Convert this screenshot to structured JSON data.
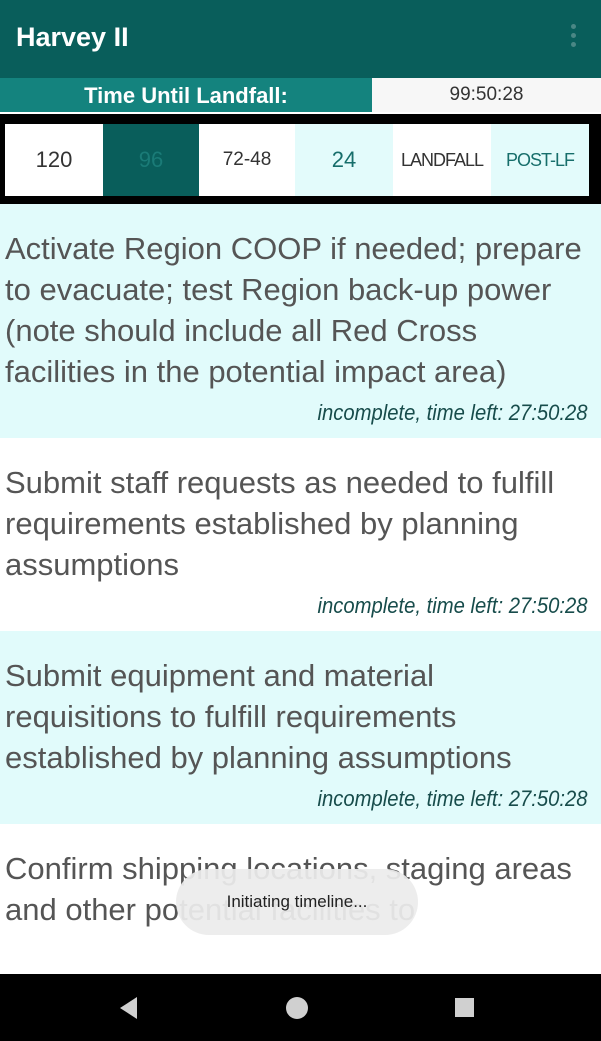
{
  "appbar": {
    "title": "Harvey II",
    "menu_icon": "more-vert-icon"
  },
  "countdown": {
    "label": "Time Until Landfall:",
    "value": "99:50:28"
  },
  "phases": [
    {
      "label": "120",
      "state": "default"
    },
    {
      "label": "96",
      "state": "selected"
    },
    {
      "label": "72-48",
      "state": "default"
    },
    {
      "label": "24",
      "state": "default"
    },
    {
      "label": "LANDFALL",
      "state": "default"
    },
    {
      "label": "POST-LF",
      "state": "default"
    }
  ],
  "tasks": [
    {
      "text": "Activate Region COOP if needed; prepare to evacuate; test Region back-up power (note should include all Red Cross facilities in the potential impact area)",
      "status": "incomplete, time left: 27:50:28"
    },
    {
      "text": "Submit staff requests as needed to fulfill requirements established by planning assumptions",
      "status": "incomplete, time left: 27:50:28"
    },
    {
      "text": "Submit equipment and material requisitions to fulfill requirements established by planning assumptions",
      "status": "incomplete, time left: 27:50:28"
    },
    {
      "text": "Confirm shipping locations, staging areas and other potential facilities to",
      "status": ""
    }
  ],
  "toast": {
    "message": "Initiating timeline..."
  },
  "navbar": {
    "back_icon": "back-icon",
    "home_icon": "home-icon",
    "recents_icon": "recents-icon"
  },
  "colors": {
    "primary": "#095e5b",
    "accent": "#14837e",
    "row_tint": "#e1fbfb"
  }
}
